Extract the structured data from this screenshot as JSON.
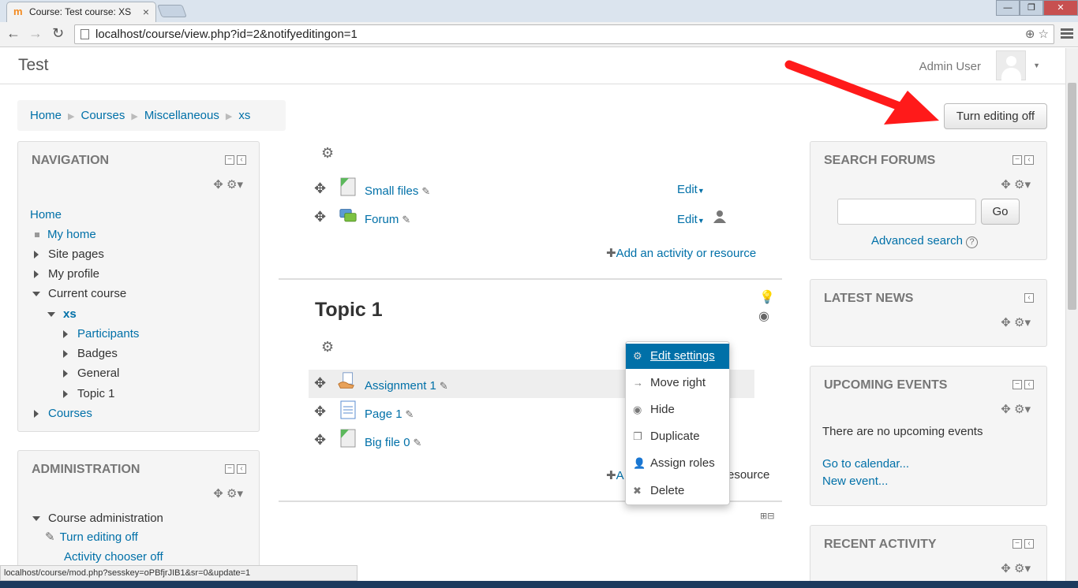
{
  "browser": {
    "tab_title": "Course: Test course: XS",
    "url": "localhost/course/view.php?id=2&notifyeditingon=1",
    "status_url": "localhost/course/mod.php?sesskey=oPBfjrJIB1&sr=0&update=1"
  },
  "header": {
    "site_name": "Test",
    "user_name": "Admin User"
  },
  "breadcrumb": [
    "Home",
    "Courses",
    "Miscellaneous",
    "xs"
  ],
  "turn_editing_off_label": "Turn editing off",
  "navigation": {
    "title": "NAVIGATION",
    "items": [
      "Home",
      "My home",
      "Site pages",
      "My profile",
      "Current course",
      "xs",
      "Participants",
      "Badges",
      "General",
      "Topic 1",
      "Courses"
    ]
  },
  "administration": {
    "title": "ADMINISTRATION",
    "items": [
      "Course administration",
      "Turn editing off",
      "Activity chooser off"
    ]
  },
  "section0": {
    "activities": [
      {
        "name": "Small files",
        "edit": "Edit"
      },
      {
        "name": "Forum",
        "edit": "Edit"
      }
    ],
    "add_label": "Add an activity or resource"
  },
  "topic1": {
    "title": "Topic 1",
    "activities": [
      {
        "name": "Assignment 1"
      },
      {
        "name": "Page 1"
      },
      {
        "name": "Big file 0"
      }
    ],
    "add_label_left": "A",
    "add_label_right": "esource"
  },
  "context_menu": [
    "Edit settings",
    "Move right",
    "Hide",
    "Duplicate",
    "Assign roles",
    "Delete"
  ],
  "search_forums": {
    "title": "SEARCH FORUMS",
    "go_label": "Go",
    "advanced_label": "Advanced search"
  },
  "latest_news": {
    "title": "LATEST NEWS"
  },
  "upcoming_events": {
    "title": "UPCOMING EVENTS",
    "empty_text": "There are no upcoming events",
    "calendar_link": "Go to calendar...",
    "new_event_link": "New event..."
  },
  "recent_activity": {
    "title": "RECENT ACTIVITY"
  },
  "colors": {
    "link": "#0070a8",
    "arrow": "#ff1a1a",
    "menu_active": "#0070a8"
  }
}
